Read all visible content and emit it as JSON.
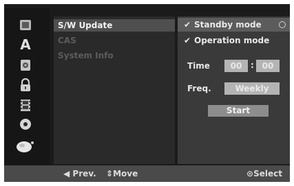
{
  "menu": {
    "items": [
      {
        "label": "S/W Update",
        "state": "selected"
      },
      {
        "label": "CAS",
        "state": "disabled"
      },
      {
        "label": "System Info",
        "state": "disabled"
      }
    ]
  },
  "options": {
    "standby_label": "Standby mode",
    "operation_label": "Operation mode",
    "time_label": "Time",
    "time_hours": "00",
    "time_minutes": "00",
    "freq_label": "Freq.",
    "freq_value": "Weekly",
    "start_label": "Start"
  },
  "footer": {
    "prev_label": "Prev.",
    "move_label": "Move",
    "select_label": "Select"
  },
  "icons": [
    "disc-icon",
    "letter-a-icon",
    "film-reel-icon",
    "lock-icon",
    "film-strip-icon",
    "record-icon",
    "globe-icon"
  ]
}
